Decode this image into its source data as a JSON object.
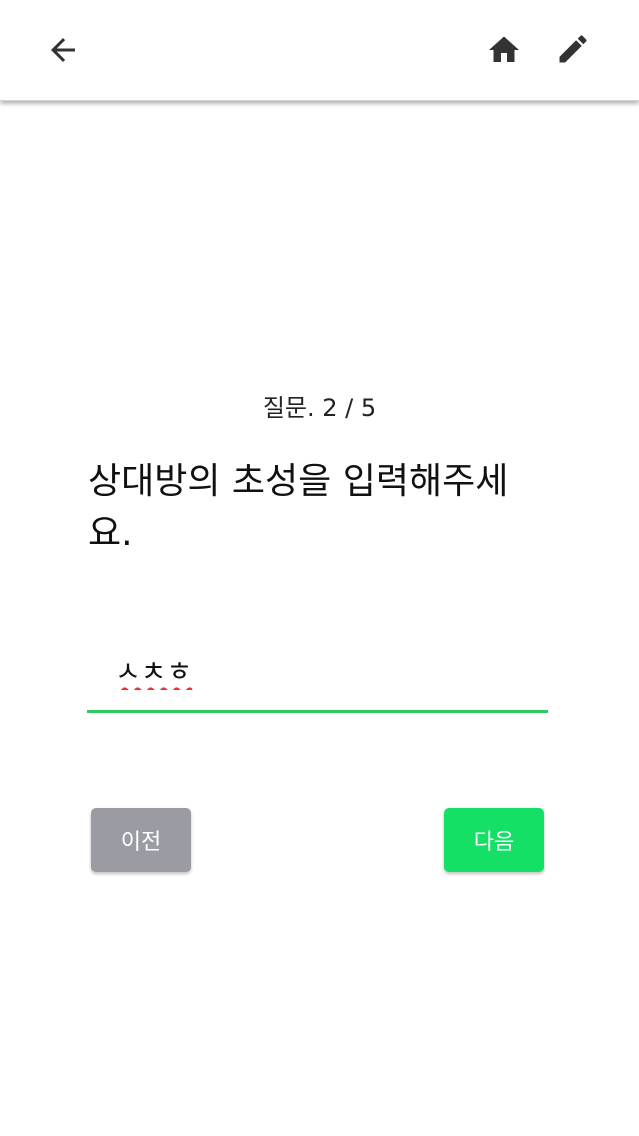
{
  "header": {
    "back_icon": "arrow-left-icon",
    "home_icon": "home-icon",
    "edit_icon": "pencil-icon"
  },
  "question": {
    "counter": "질문. 2 / 5",
    "text": "상대방의 초성을 입력해주세요."
  },
  "answer": {
    "value": "ㅅㅊㅎ"
  },
  "buttons": {
    "prev_label": "이전",
    "next_label": "다음"
  },
  "colors": {
    "accent": "#14e066",
    "underline": "#2ecc5f",
    "prev_button": "#9b9ca3"
  }
}
